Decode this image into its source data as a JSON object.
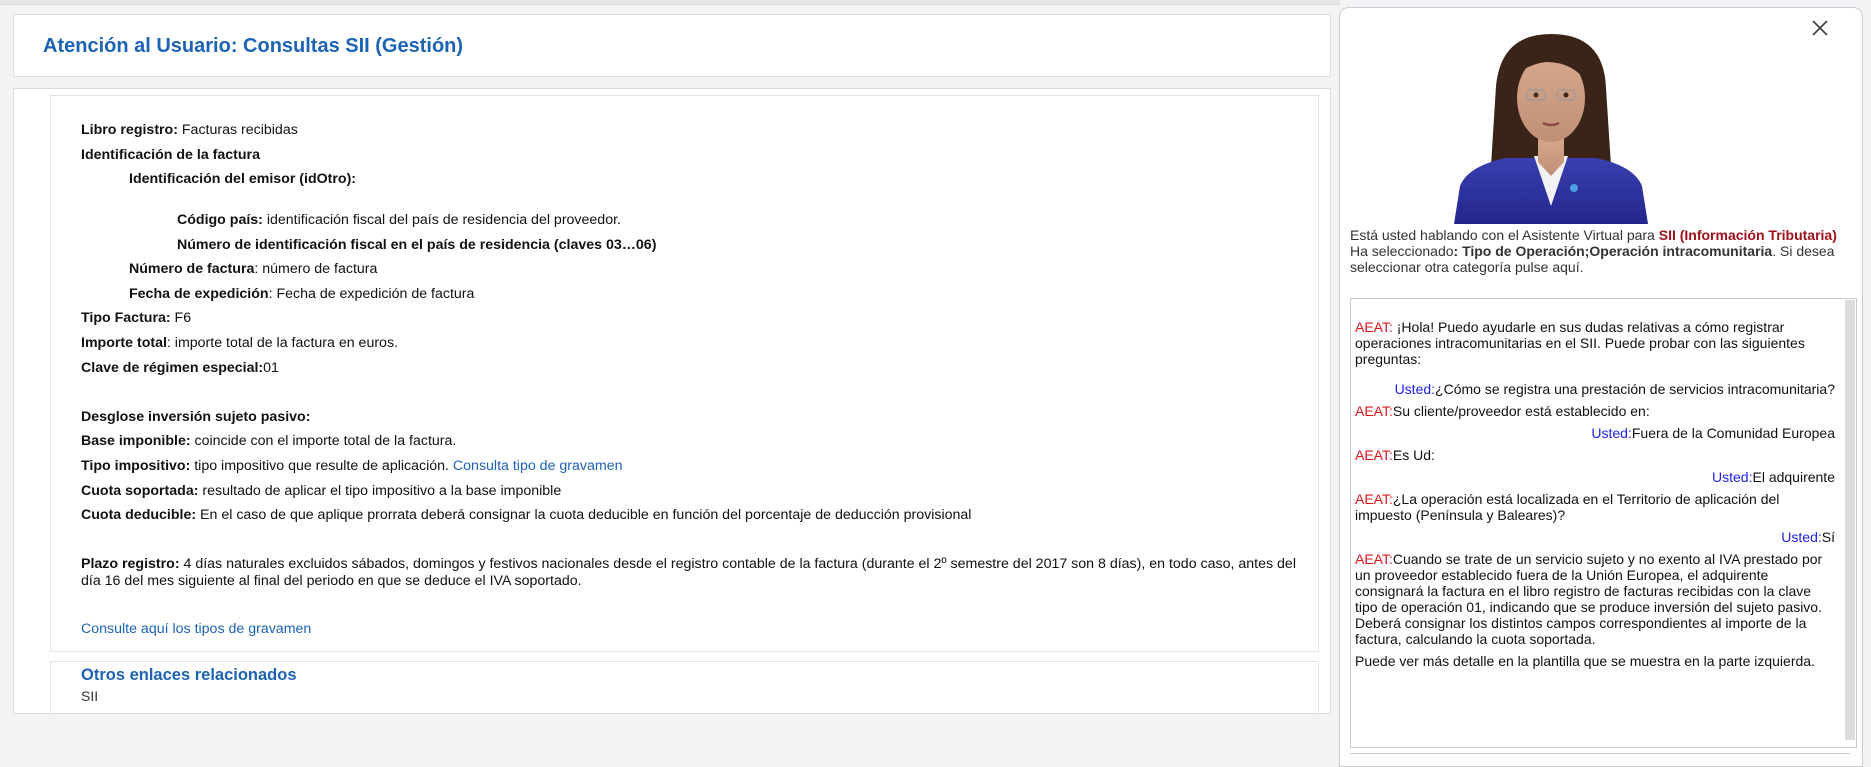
{
  "header": {
    "title": "Atención al Usuario: Consultas SII (Gestión)"
  },
  "detail": {
    "libro": {
      "label": "Libro registro:",
      "value": " Facturas recibidas"
    },
    "id_factura": "Identificación de la factura",
    "id_emisor": "Identificación del emisor (idOtro):",
    "codigo_pais": {
      "label": "Código país:",
      "value": " identificación fiscal del país de residencia del proveedor."
    },
    "num_id": "Número de identificación fiscal en el país de residencia (claves 03…06)",
    "num_factura": {
      "label": "Número de factura",
      "value": ": número de factura"
    },
    "fecha": {
      "label": "Fecha de expedición",
      "value": ": Fecha de expedición de factura"
    },
    "tipo_factura": {
      "label": "Tipo Factura:",
      "value": " F6"
    },
    "importe": {
      "label": "Importe total",
      "value": ": importe total de la factura en euros."
    },
    "clave": {
      "label": "Clave de régimen especial:",
      "value": "01"
    },
    "desglose": "Desglose inversión sujeto pasivo:",
    "base": {
      "label": "Base imponible:",
      "value": " coincide con el importe total de la factura."
    },
    "tipo_imp": {
      "label": "Tipo impositivo:",
      "value": " tipo impositivo que resulte de aplicación. ",
      "link": "Consulta tipo de gravamen"
    },
    "cuota_sop": {
      "label": "Cuota soportada:",
      "value": " resultado de aplicar el tipo impositivo a la base imponible"
    },
    "cuota_ded": {
      "label": "Cuota deducible:",
      "value": " En el caso de que aplique prorrata deberá consignar la cuota deducible en función del porcentaje de deducción provisional"
    },
    "plazo": {
      "label": "Plazo registro:",
      "value": " 4 días naturales excluidos sábados, domingos y festivos nacionales desde el registro contable de la factura (durante el 2º semestre del 2017 son 8 días), en todo caso, antes del día 16 del mes siguiente al final del periodo en que se deduce el IVA soportado."
    },
    "consulte_link": "Consulte aquí los tipos de gravamen"
  },
  "related": {
    "title": "Otros enlaces relacionados",
    "link": "SII"
  },
  "assistant": {
    "intro_1": "Está usted hablando con el Asistente Virtual para ",
    "intro_red": "SII (Información Tributaria)",
    "intro_2": "Ha seleccionado",
    "intro_bold": ": Tipo de Operación;Operación intracomunitaria",
    "intro_3": ". Si desea seleccionar otra categoría pulse aquí.",
    "aeat": "AEAT:",
    "usted": "Usted:",
    "messages": {
      "m1": " ¡Hola! Puedo ayudarle en sus dudas relativas a cómo registrar operaciones intracomunitarias en el SII. Puede probar con las siguientes preguntas:",
      "m2": "¿Cómo se registra una prestación de servicios intracomunitaria?",
      "m3": "Su cliente/proveedor está establecido en:",
      "m4": "Fuera de la Comunidad Europea",
      "m5": "Es Ud:",
      "m6": "El adquirente",
      "m7": "¿La operación está localizada en el Territorio de aplicación del impuesto (Península y Baleares)?",
      "m8": "Sí",
      "m9": "Cuando se trate de un servicio sujeto y no exento al IVA prestado por un proveedor establecido fuera de la Unión Europea, el adquirente consignará la factura en el libro registro de facturas recibidas con la clave tipo de operación 01, indicando que se produce inversión del sujeto pasivo. Deberá consignar los distintos campos correspondientes al importe de la factura, calculando la cuota soportada.",
      "m10": "Puede ver más detalle en la plantilla que se muestra en la parte izquierda."
    }
  }
}
